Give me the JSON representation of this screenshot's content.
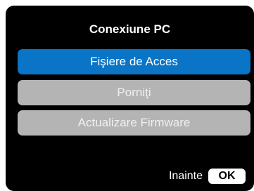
{
  "dialog": {
    "title": "Conexiune PC"
  },
  "menu": {
    "items": [
      {
        "label": "Fişiere de Acces",
        "selected": true
      },
      {
        "label": "Porniţi",
        "selected": false
      },
      {
        "label": "Actualizare Firmware",
        "selected": false
      }
    ]
  },
  "footer": {
    "next_label": "Inainte",
    "ok_label": "OK"
  },
  "colors": {
    "background": "#000000",
    "selected_item": "#0a74c6",
    "unselected_item": "#b4b4b4",
    "text": "#ffffff"
  }
}
